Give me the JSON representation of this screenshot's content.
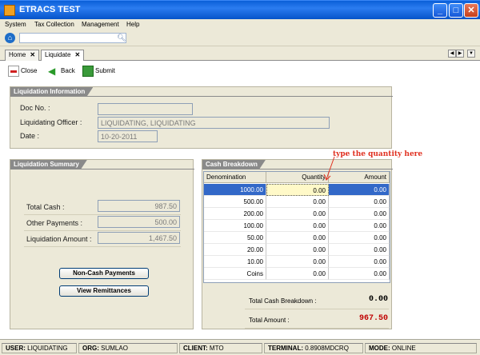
{
  "window": {
    "title": "ETRACS TEST"
  },
  "menu": [
    "System",
    "Tax Collection",
    "Management",
    "Help"
  ],
  "search": {
    "value": ""
  },
  "tabs": [
    {
      "label": "Home",
      "close": "✕"
    },
    {
      "label": "Liquidate",
      "close": "✕"
    }
  ],
  "actions": {
    "close": "Close",
    "back": "Back",
    "submit": "Submit"
  },
  "liquidation_info": {
    "title": "Liquidation Information",
    "doc_no_label": "Doc No. :",
    "doc_no_value": "",
    "officer_label": "Liquidating Officer :",
    "officer_value": "LIQUIDATING, LIQUIDATING",
    "date_label": "Date :",
    "date_value": "10-20-2011"
  },
  "liquidation_summary": {
    "title": "Liquidation Summary",
    "total_cash_label": "Total Cash :",
    "total_cash_value": "987.50",
    "other_payments_label": "Other Payments :",
    "other_payments_value": "500.00",
    "liquidation_amount_label": "Liquidation Amount :",
    "liquidation_amount_value": "1,467.50",
    "noncash_button": "Non-Cash Payments",
    "remittances_button": "View Remittances"
  },
  "cash_breakdown": {
    "title": "Cash Breakdown",
    "columns": [
      "Denomination",
      "Quantity",
      "Amount"
    ],
    "rows": [
      {
        "denomination": "1000.00",
        "quantity": "0.00",
        "amount": "0.00"
      },
      {
        "denomination": "500.00",
        "quantity": "0.00",
        "amount": "0.00"
      },
      {
        "denomination": "200.00",
        "quantity": "0.00",
        "amount": "0.00"
      },
      {
        "denomination": "100.00",
        "quantity": "0.00",
        "amount": "0.00"
      },
      {
        "denomination": "50.00",
        "quantity": "0.00",
        "amount": "0.00"
      },
      {
        "denomination": "20.00",
        "quantity": "0.00",
        "amount": "0.00"
      },
      {
        "denomination": "10.00",
        "quantity": "0.00",
        "amount": "0.00"
      },
      {
        "denomination": "Coins",
        "quantity": "0.00",
        "amount": "0.00"
      }
    ],
    "total_breakdown_label": "Total Cash Breakdown :",
    "total_breakdown_value": "0.00",
    "total_amount_label": "Total Amount :",
    "total_amount_value": "967.50",
    "annotation": "type the quantity here"
  },
  "status": {
    "user_label": "USER:",
    "user_value": "LIQUIDATING",
    "org_label": "ORG:",
    "org_value": "SUMLAO",
    "client_label": "CLIENT:",
    "client_value": "MTO",
    "terminal_label": "TERMINAL:",
    "terminal_value": "0.8908MDCRQ",
    "mode_label": "MODE:",
    "mode_value": "ONLINE"
  },
  "colors": {
    "titlebar": "#0553c9",
    "selection": "#3268c8",
    "total_amount": "#c00000",
    "annotation": "#e03020"
  }
}
